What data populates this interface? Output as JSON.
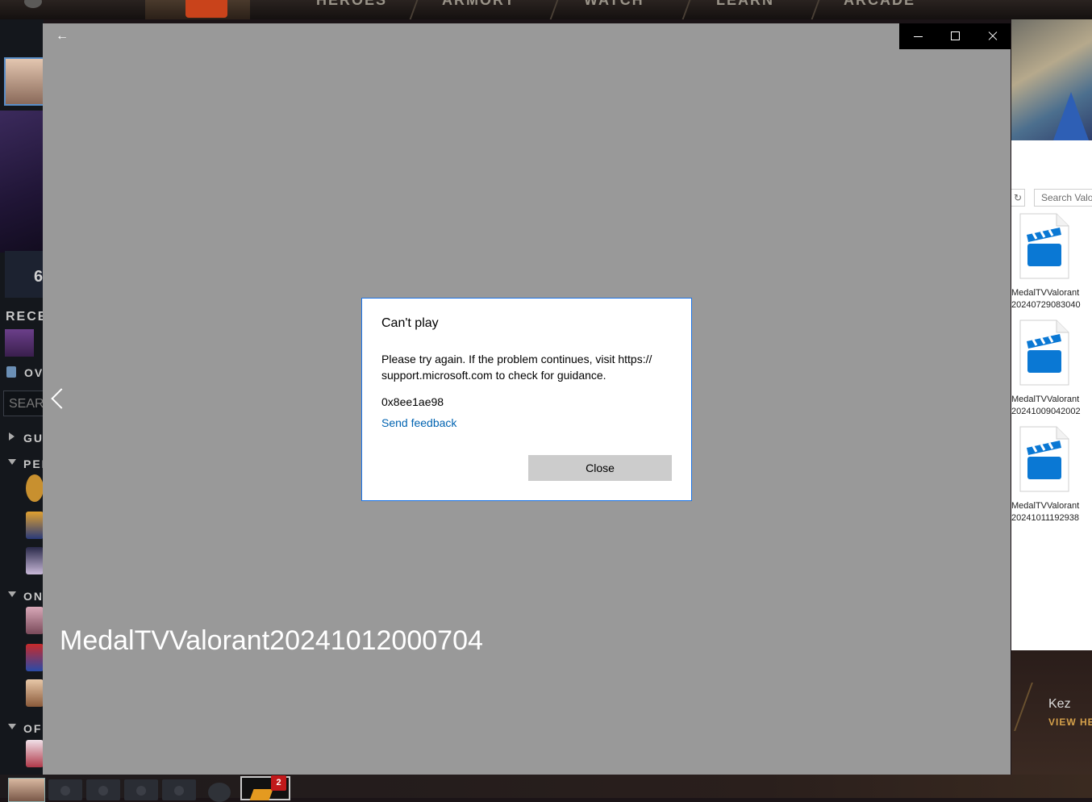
{
  "background_app": {
    "nav": [
      "HEROES",
      "ARMORY",
      "WATCH",
      "LEARN",
      "ARCADE"
    ],
    "left_rail": {
      "stat_value": "6",
      "recent_label": "RECE",
      "overview_label": "OV",
      "search_placeholder": "SEARC",
      "sections": [
        "GU",
        "PEN",
        "ON",
        "OFF"
      ]
    },
    "bottom_bar": {
      "notification_count": "2"
    },
    "featured_hero": {
      "name": "Kez",
      "link": "VIEW HE"
    }
  },
  "explorer": {
    "search_placeholder": "Search Valor",
    "files": [
      {
        "name_line1": "MedalTVValorant",
        "name_line2": "20240729083040"
      },
      {
        "name_line1": "MedalTVValorant",
        "name_line2": "20241009042002"
      },
      {
        "name_line1": "MedalTVValorant",
        "name_line2": "20241011192938"
      }
    ]
  },
  "player": {
    "media_title": "MedalTVValorant20241012000704",
    "back_icon": "arrow-left-icon",
    "prev_icon": "chevron-left-icon"
  },
  "dialog": {
    "title": "Can't play",
    "message": "Please try again. If the problem continues, visit https:// support.microsoft.com to check for guidance.",
    "error_code": "0x8ee1ae98",
    "feedback_link": "Send feedback",
    "close_label": "Close"
  },
  "colors": {
    "player_bg": "#999999",
    "dialog_border": "#1a73e8",
    "link": "#0063b1",
    "close_button": "#cccccc"
  }
}
